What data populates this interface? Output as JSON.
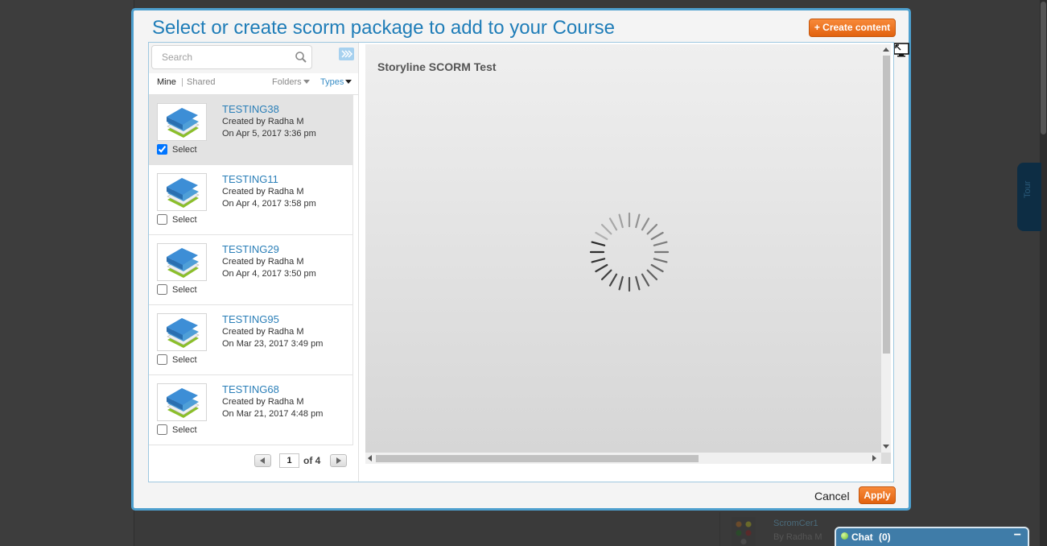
{
  "modal": {
    "title": "Select or create scorm package to add to your Course",
    "create_button": "+ Create content",
    "cancel_label": "Cancel",
    "apply_label": "Apply"
  },
  "search": {
    "placeholder": "Search",
    "value": ""
  },
  "filters": {
    "mine": "Mine",
    "separator": "|",
    "shared": "Shared",
    "folders": "Folders",
    "types": "Types"
  },
  "items": [
    {
      "title": "TESTING38",
      "created_by": "Created by Radha M",
      "created_on": "On Apr 5, 2017 3:36 pm",
      "select_label": "Select",
      "checked": true
    },
    {
      "title": "TESTING11",
      "created_by": "Created by Radha M",
      "created_on": "On Apr 4, 2017 3:58 pm",
      "select_label": "Select",
      "checked": false
    },
    {
      "title": "TESTING29",
      "created_by": "Created by Radha M",
      "created_on": "On Apr 4, 2017 3:50 pm",
      "select_label": "Select",
      "checked": false
    },
    {
      "title": "TESTING95",
      "created_by": "Created by Radha M",
      "created_on": "On Mar 23, 2017 3:49 pm",
      "select_label": "Select",
      "checked": false
    },
    {
      "title": "TESTING68",
      "created_by": "Created by Radha M",
      "created_on": "On Mar 21, 2017 4:48 pm",
      "select_label": "Select",
      "checked": false
    }
  ],
  "pager": {
    "current_page": "1",
    "of_label": "of 4"
  },
  "preview": {
    "title": "Storyline SCORM Test"
  },
  "background": {
    "tour_label": "Tour",
    "card_title": "ScromCer1",
    "card_by": "By Radha M"
  },
  "chat": {
    "label": "Chat",
    "count": "(0)",
    "minimize": "−"
  },
  "colors": {
    "accent": "#1f7db8",
    "button_orange": "#e2620f",
    "modal_border": "#4d9fce",
    "chat_blue": "#3f7ca8"
  },
  "icons": {
    "search": "search-icon",
    "expand": "double-chevron-right-icon",
    "fullscreen": "fullscreen-icon",
    "thumbnail": "books-icon",
    "loading": "spinner-icon",
    "chat_status": "online-dot-icon"
  }
}
